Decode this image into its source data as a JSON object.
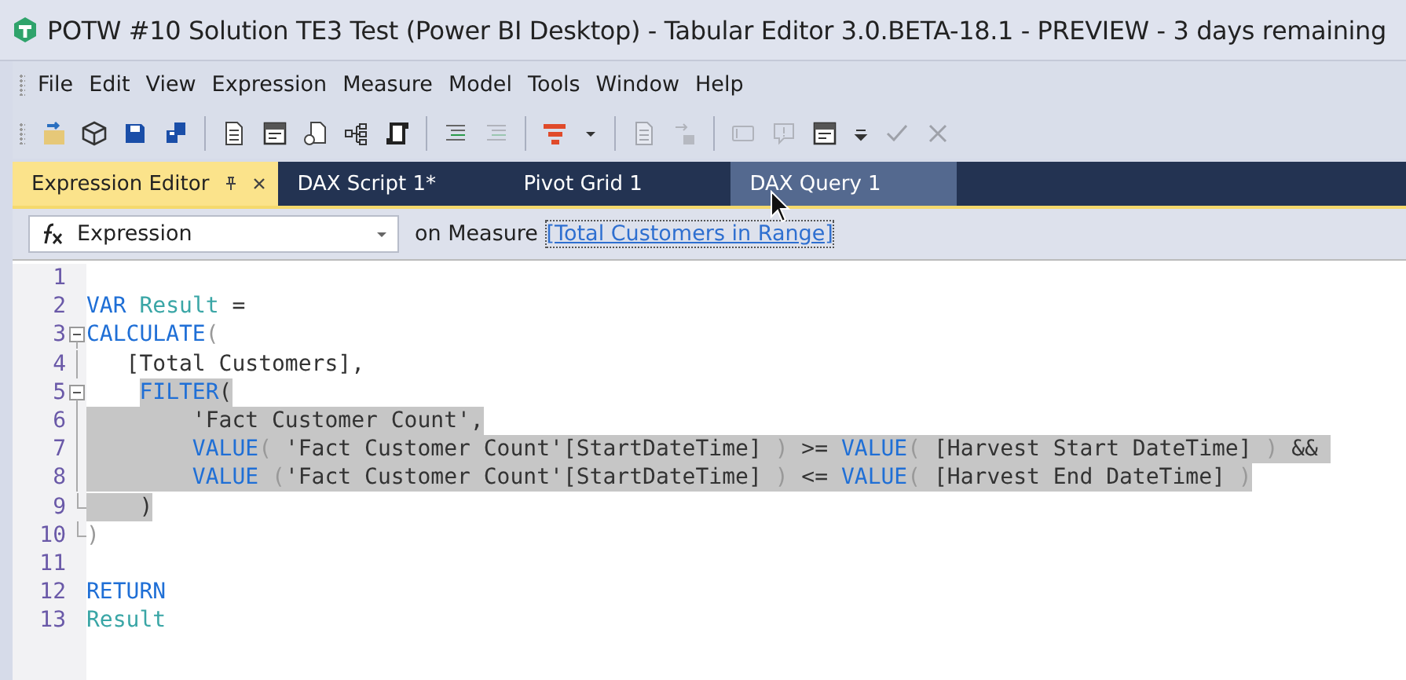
{
  "window": {
    "title": "POTW #10 Solution TE3 Test (Power BI Desktop) - Tabular Editor 3.0.BETA-18.1 - PREVIEW - 3 days remaining"
  },
  "menu": [
    "File",
    "Edit",
    "View",
    "Expression",
    "Measure",
    "Model",
    "Tools",
    "Window",
    "Help"
  ],
  "toolbar": [
    {
      "kind": "open",
      "disabled": false
    },
    {
      "kind": "cube",
      "disabled": false
    },
    {
      "kind": "save",
      "disabled": false
    },
    {
      "kind": "saveall",
      "disabled": false
    },
    {
      "kind": "sep"
    },
    {
      "kind": "doc",
      "disabled": false
    },
    {
      "kind": "form",
      "disabled": false
    },
    {
      "kind": "docgear",
      "disabled": false
    },
    {
      "kind": "tree",
      "disabled": false
    },
    {
      "kind": "script",
      "disabled": false
    },
    {
      "kind": "sep"
    },
    {
      "kind": "lines",
      "disabled": false
    },
    {
      "kind": "lines",
      "disabled": true
    },
    {
      "kind": "sep"
    },
    {
      "kind": "bars",
      "disabled": false
    },
    {
      "kind": "caret",
      "disabled": false
    },
    {
      "kind": "sep"
    },
    {
      "kind": "doc",
      "disabled": true
    },
    {
      "kind": "arrowin",
      "disabled": true
    },
    {
      "kind": "sep"
    },
    {
      "kind": "panel",
      "disabled": true
    },
    {
      "kind": "comment",
      "disabled": true
    },
    {
      "kind": "form",
      "disabled": false
    },
    {
      "kind": "overflow",
      "disabled": false
    },
    {
      "kind": "check",
      "disabled": true
    },
    {
      "kind": "close",
      "disabled": true
    }
  ],
  "tabs": [
    {
      "label": "Expression Editor",
      "selected": true,
      "hovered": false
    },
    {
      "label": "DAX Script 1*",
      "selected": false,
      "hovered": false
    },
    {
      "label": "Pivot Grid 1",
      "selected": false,
      "hovered": false
    },
    {
      "label": "DAX Query 1",
      "selected": false,
      "hovered": true
    }
  ],
  "expression_bar": {
    "property": "Expression",
    "prefix": "on Measure ",
    "link": "[Total Customers in Range]"
  },
  "code": [
    {
      "number": "1",
      "kind": "none"
    },
    {
      "number": "2",
      "kind": "none",
      "selected": false,
      "tokens": [
        {
          "kind": "kw",
          "text": "VAR"
        },
        {
          "kind": "var",
          "text": " Result"
        },
        {
          "kind": "plain",
          "text": " ="
        }
      ]
    },
    {
      "number": "3",
      "kind": "start",
      "selected": false,
      "tokens": [
        {
          "kind": "kw",
          "text": "CALCULATE"
        },
        {
          "kind": "paren",
          "text": "("
        }
      ]
    },
    {
      "number": "4",
      "kind": "mid",
      "selected": false,
      "tokens": [
        {
          "kind": "plain",
          "text": "   [Total Customers],"
        }
      ]
    },
    {
      "number": "5",
      "kind": "start",
      "selected": true,
      "selected_indent": false,
      "tokens": [
        {
          "kind": "kw",
          "text": "    FILTER"
        },
        {
          "kind": "plain",
          "text": "("
        }
      ]
    },
    {
      "number": "6",
      "kind": "mid",
      "selected": true,
      "selected_indent": true,
      "tokens": [
        {
          "kind": "plain",
          "text": "        'Fact Customer Count',"
        }
      ]
    },
    {
      "number": "7",
      "kind": "mid",
      "selected": true,
      "selected_indent": true,
      "tokens": [
        {
          "kind": "kw",
          "text": "        VALUE"
        },
        {
          "kind": "paren",
          "text": "("
        },
        {
          "kind": "plain",
          "text": " 'Fact Customer Count'[StartDateTime] "
        },
        {
          "kind": "paren",
          "text": ")"
        },
        {
          "kind": "plain",
          "text": " >= "
        },
        {
          "kind": "kw",
          "text": "VALUE"
        },
        {
          "kind": "paren",
          "text": "("
        },
        {
          "kind": "plain",
          "text": " [Harvest Start DateTime] "
        },
        {
          "kind": "paren",
          "text": ")"
        },
        {
          "kind": "plain",
          "text": " && "
        }
      ]
    },
    {
      "number": "8",
      "kind": "mid",
      "selected": true,
      "selected_indent": true,
      "tokens": [
        {
          "kind": "kw",
          "text": "        VALUE"
        },
        {
          "kind": "paren",
          "text": " ("
        },
        {
          "kind": "plain",
          "text": "'Fact Customer Count'[StartDateTime] "
        },
        {
          "kind": "paren",
          "text": ")"
        },
        {
          "kind": "plain",
          "text": " <= "
        },
        {
          "kind": "kw",
          "text": "VALUE"
        },
        {
          "kind": "paren",
          "text": "("
        },
        {
          "kind": "plain",
          "text": " [Harvest End DateTime] "
        },
        {
          "kind": "paren",
          "text": ")"
        }
      ]
    },
    {
      "number": "9",
      "kind": "end",
      "selected": true,
      "selected_indent": true,
      "tokens": [
        {
          "kind": "plain",
          "text": "    )"
        }
      ]
    },
    {
      "number": "10",
      "kind": "end",
      "selected": false,
      "tokens": [
        {
          "kind": "paren",
          "text": ")"
        }
      ]
    },
    {
      "number": "11",
      "kind": "none"
    },
    {
      "number": "12",
      "kind": "none",
      "selected": false,
      "tokens": [
        {
          "kind": "kw",
          "text": "RETURN"
        }
      ]
    },
    {
      "number": "13",
      "kind": "none",
      "selected": false,
      "tokens": [
        {
          "kind": "var",
          "text": "Result"
        }
      ]
    }
  ]
}
